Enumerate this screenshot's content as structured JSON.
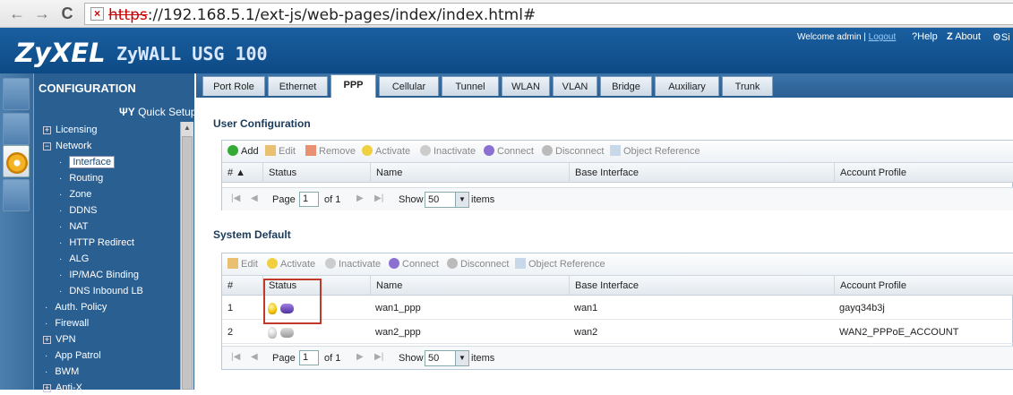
{
  "browser": {
    "url_scheme": "https",
    "url_rest": "://192.168.5.1/ext-js/web-pages/index/index.html#",
    "back": "←",
    "forward": "→",
    "reload": "C"
  },
  "header": {
    "logo": "ZyXEL",
    "product": "ZyWALL USG 100",
    "welcome": "Welcome admin |",
    "logout": "Logout",
    "help": "Help",
    "about": "About",
    "site": "Si"
  },
  "sidebar": {
    "title": "CONFIGURATION",
    "quick_setup": "Quick Setup",
    "items": [
      {
        "label": "Licensing",
        "kind": "plus"
      },
      {
        "label": "Network",
        "kind": "minus"
      },
      {
        "label": "Interface",
        "kind": "sub",
        "selected": true
      },
      {
        "label": "Routing",
        "kind": "sub"
      },
      {
        "label": "Zone",
        "kind": "sub"
      },
      {
        "label": "DDNS",
        "kind": "sub"
      },
      {
        "label": "NAT",
        "kind": "sub"
      },
      {
        "label": "HTTP Redirect",
        "kind": "sub"
      },
      {
        "label": "ALG",
        "kind": "sub"
      },
      {
        "label": "IP/MAC Binding",
        "kind": "sub"
      },
      {
        "label": "DNS Inbound LB",
        "kind": "sub"
      },
      {
        "label": "Auth. Policy",
        "kind": "dot"
      },
      {
        "label": "Firewall",
        "kind": "dot"
      },
      {
        "label": "VPN",
        "kind": "plus"
      },
      {
        "label": "App Patrol",
        "kind": "dot"
      },
      {
        "label": "BWM",
        "kind": "dot"
      },
      {
        "label": "Anti-X",
        "kind": "plus"
      }
    ]
  },
  "tabs": [
    {
      "label": "Port Role"
    },
    {
      "label": "Ethernet"
    },
    {
      "label": "PPP",
      "active": true
    },
    {
      "label": "Cellular"
    },
    {
      "label": "Tunnel"
    },
    {
      "label": "WLAN"
    },
    {
      "label": "VLAN"
    },
    {
      "label": "Bridge"
    },
    {
      "label": "Auxiliary"
    },
    {
      "label": "Trunk"
    }
  ],
  "user_config": {
    "title": "User Configuration",
    "toolbar": {
      "add": "Add",
      "edit": "Edit",
      "remove": "Remove",
      "activate": "Activate",
      "inactivate": "Inactivate",
      "connect": "Connect",
      "disconnect": "Disconnect",
      "object_reference": "Object Reference"
    },
    "columns": {
      "num": "# ▲",
      "status": "Status",
      "name": "Name",
      "base_interface": "Base Interface",
      "account_profile": "Account Profile"
    },
    "pager": {
      "page": "Page",
      "page_value": "1",
      "of": "of 1",
      "show": "Show",
      "show_value": "50",
      "items": "items"
    }
  },
  "system_default": {
    "title": "System Default",
    "toolbar": {
      "edit": "Edit",
      "activate": "Activate",
      "inactivate": "Inactivate",
      "connect": "Connect",
      "disconnect": "Disconnect",
      "object_reference": "Object Reference"
    },
    "columns": {
      "num": "#",
      "status": "Status",
      "name": "Name",
      "base_interface": "Base Interface",
      "account_profile": "Account Profile"
    },
    "rows": [
      {
        "num": "1",
        "name": "wan1_ppp",
        "base_interface": "wan1",
        "account_profile": "gayq34b3j",
        "active": true
      },
      {
        "num": "2",
        "name": "wan2_ppp",
        "base_interface": "wan2",
        "account_profile": "WAN2_PPPoE_ACCOUNT",
        "active": false
      }
    ],
    "pager": {
      "page": "Page",
      "page_value": "1",
      "of": "of 1",
      "show": "Show",
      "show_value": "50",
      "items": "items"
    }
  },
  "colors": {
    "header_blue": "#1a5fa0",
    "sidebar_blue": "#2a5f92",
    "highlight_red": "#c0392b"
  }
}
